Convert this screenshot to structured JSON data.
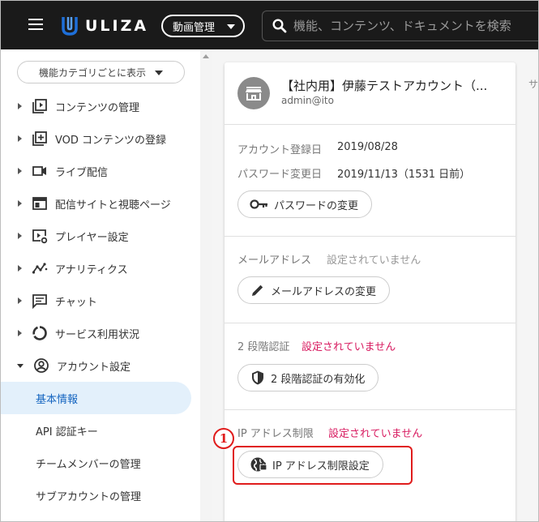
{
  "header": {
    "logo_text": "ULIZA",
    "mode_label": "動画管理",
    "search_placeholder": "機能、コンテンツ、ドキュメントを検索"
  },
  "sidebar": {
    "category_button": "機能カテゴリごとに表示",
    "items": [
      {
        "label": "コンテンツの管理",
        "icon": "play-box-icon"
      },
      {
        "label": "VOD コンテンツの登録",
        "icon": "add-box-icon"
      },
      {
        "label": "ライブ配信",
        "icon": "video-camera-icon"
      },
      {
        "label": "配信サイトと視聴ページ",
        "icon": "web-page-icon"
      },
      {
        "label": "プレイヤー設定",
        "icon": "player-settings-icon"
      },
      {
        "label": "アナリティクス",
        "icon": "analytics-icon"
      },
      {
        "label": "チャット",
        "icon": "chat-icon"
      },
      {
        "label": "サービス利用状況",
        "icon": "usage-ring-icon"
      },
      {
        "label": "アカウント設定",
        "icon": "account-circle-icon"
      }
    ],
    "sub_items": [
      {
        "label": "基本情報",
        "active": true
      },
      {
        "label": "API 認証キー",
        "active": false
      },
      {
        "label": "チームメンバーの管理",
        "active": false
      },
      {
        "label": "サブアカウントの管理",
        "active": false
      }
    ]
  },
  "account": {
    "name": "【社内用】伊藤テストアカウント（...",
    "id": "admin@ito",
    "registered_label": "アカウント登録日",
    "registered_value": "2019/08/28",
    "password_changed_label": "パスワード変更日",
    "password_changed_value": "2019/11/13（1531 日前）",
    "password_button": "パスワードの変更",
    "email_label": "メールアドレス",
    "email_status": "設定されていません",
    "email_button": "メールアドレスの変更",
    "twofa_label": "2 段階認証",
    "twofa_status": "設定されていません",
    "twofa_button": "2 段階認証の有効化",
    "ip_label": "IP アドレス制限",
    "ip_status": "設定されていません",
    "ip_button": "IP アドレス制限設定"
  },
  "edge_text": "サ",
  "callout_number": "1",
  "colors": {
    "header_bg": "#1a1a1a",
    "logo_accent": "#1e6fd9",
    "warning": "#d81b60",
    "highlight": "#e01c1c",
    "active_bg": "#e3f0fb"
  }
}
